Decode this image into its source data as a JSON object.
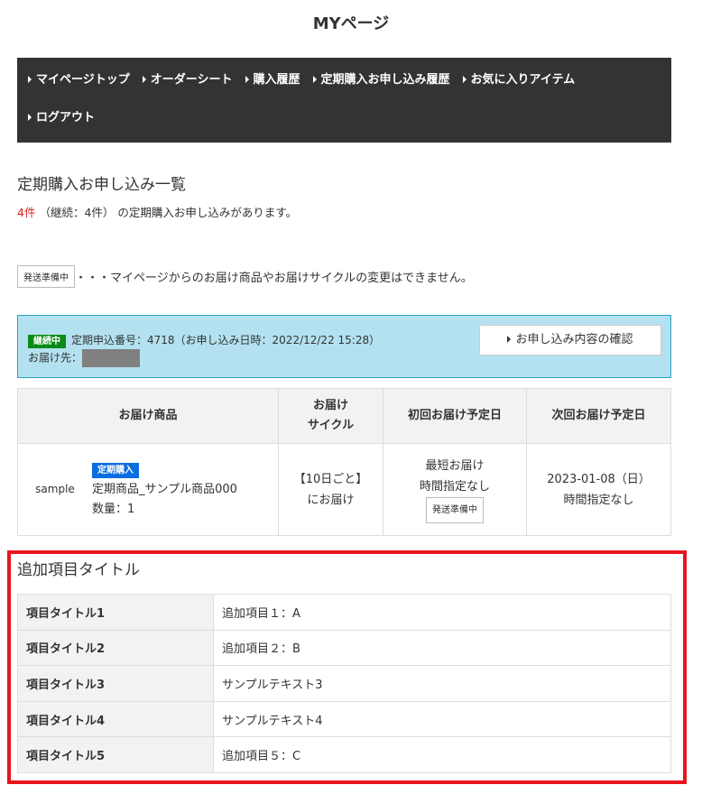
{
  "page_title": "MYページ",
  "nav": [
    "マイページトップ",
    "オーダーシート",
    "購入履歴",
    "定期購入お申し込み履歴",
    "お気に入りアイテム",
    "ログアウト"
  ],
  "section_title": "定期購入お申し込み一覧",
  "count": {
    "total": "4件",
    "detail": "（継続：4件）",
    "suffix": "の定期購入お申し込みがあります。"
  },
  "note": {
    "tag": "発送準備中",
    "text": "・・・マイページからのお届け商品やお届けサイクルの変更はできません。"
  },
  "order": {
    "status": "継続中",
    "number": "定期申込番号：4718（お申し込み日時：2022/12/22 15:28）",
    "address_label": "お届け先：",
    "confirm_button": "お申し込み内容の確認"
  },
  "table": {
    "headers": [
      "お届け商品",
      "お届け",
      "サイクル",
      "初回お届け予定日",
      "次回お届け予定日"
    ],
    "row": {
      "image_alt": "sample",
      "badge": "定期購入",
      "product": "定期商品_サンプル商品000",
      "quantity": "数量：1",
      "cycle1": "【10日ごと】",
      "cycle2": "にお届け",
      "first1": "最短お届け",
      "first2": "時間指定なし",
      "first_tag": "発送準備中",
      "next1": "2023-01-08（日）",
      "next2": "時間指定なし"
    }
  },
  "extra": {
    "title": "追加項目タイトル",
    "rows": [
      {
        "k": "項目タイトル1",
        "v": "追加項目１：A"
      },
      {
        "k": "項目タイトル2",
        "v": "追加項目２：B"
      },
      {
        "k": "項目タイトル3",
        "v": "サンプルテキスト3"
      },
      {
        "k": "項目タイトル4",
        "v": "サンプルテキスト4"
      },
      {
        "k": "項目タイトル5",
        "v": "追加項目５：C"
      }
    ]
  },
  "colors": {
    "nav_bg": "#333333",
    "info_bg": "#b3e1f0",
    "status_green": "#0a8a16",
    "badge_blue": "#0a6ee0",
    "highlight_red": "#e8141e"
  }
}
